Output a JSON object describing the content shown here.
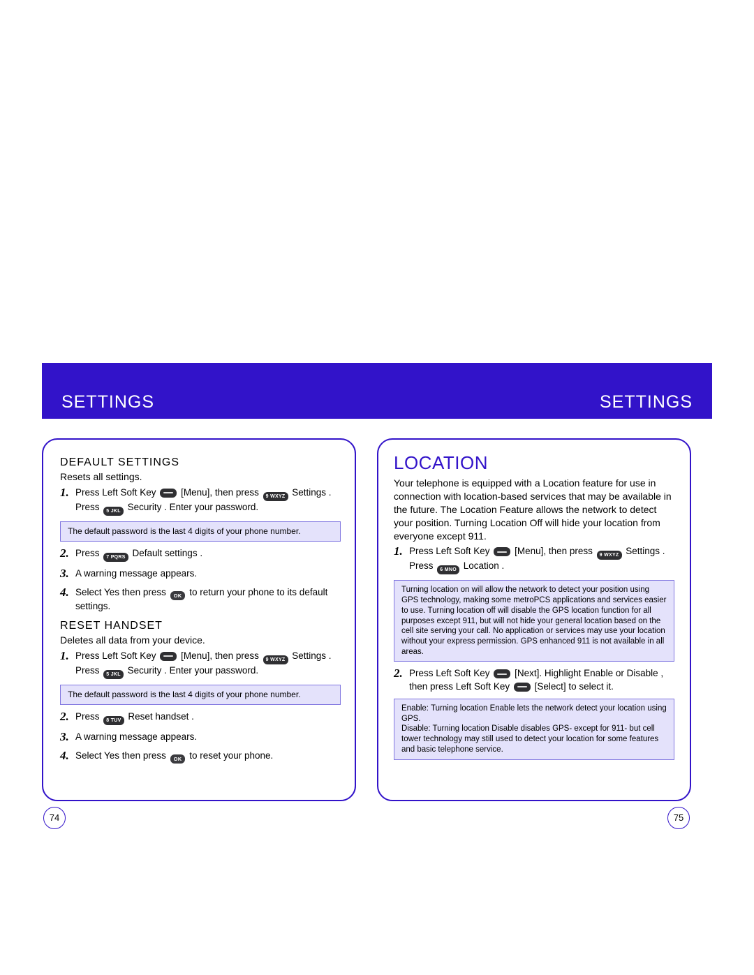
{
  "band": {
    "left": "SETTINGS",
    "right": "SETTINGS"
  },
  "left": {
    "sec1_title": "DEFAULT SETTINGS",
    "sec1_sub": "Resets all settings.",
    "sec1_step1_a": "Press Left Soft Key ",
    "sec1_step1_b": " [Menu], then press ",
    "sec1_step1_c": "  Settings  . Press ",
    "sec1_step1_d": "  Security  . Enter your password.",
    "sec1_note": "The default password is the last 4 digits of your phone number.",
    "sec1_step2_a": "Press ",
    "sec1_step2_b": "  Default settings  .",
    "sec1_step3": "A warning message appears.",
    "sec1_step4_a": "Select  Yes  then press ",
    "sec1_step4_b": " to return your phone to its default settings.",
    "sec2_title": "RESET HANDSET",
    "sec2_sub": "Deletes all data from your device.",
    "sec2_step1_a": "Press Left Soft Key ",
    "sec2_step1_b": " [Menu], then press ",
    "sec2_step1_c": "  Settings  . Press ",
    "sec2_step1_d": "  Security  . Enter your password.",
    "sec2_note": "The default password is the last 4 digits of your phone number.",
    "sec2_step2_a": "Press ",
    "sec2_step2_b": "  Reset handset  .",
    "sec2_step3": "A warning message appears.",
    "sec2_step4_a": "Select  Yes  then press ",
    "sec2_step4_b": " to reset your phone."
  },
  "right": {
    "title": "LOCATION",
    "intro": "Your telephone is equipped with a Location feature for use in connection with location-based services that may be available in the future. The Location Feature allows the network to detect your position. Turning Location Off will hide your location from everyone except 911.",
    "step1_a": "Press Left Soft Key ",
    "step1_b": " [Menu], then press ",
    "step1_c": "  Settings  . Press ",
    "step1_d": "  Location  .",
    "note1": "Turning location on will allow the network to detect your position using GPS technology, making some metroPCS applications and services easier to use. Turning location off will disable the GPS location function for all purposes except 911, but will not hide your general location based on the cell site serving your call. No application or services may use your location without your express permission. GPS enhanced 911 is not available in all areas.",
    "step2_a": "Press Left Soft Key ",
    "step2_b": " [Next]. Highlight  Enable  or  Disable , then press Left Soft Key ",
    "step2_c": " [Select] to select it.",
    "note2": "Enable: Turning location  Enable  lets the network detect your location using GPS.\nDisable: Turning location  Disable  disables GPS- except for 911- but cell tower technology may still used to detect your location for some features and basic telephone service."
  },
  "keys": {
    "k9": "9 WXYZ",
    "k5": "5 JKL",
    "k6": "6 MNO",
    "k7": "7 PQRS",
    "k8": "8 TUV",
    "ok": "OK"
  },
  "pagenums": {
    "left": "74",
    "right": "75"
  }
}
